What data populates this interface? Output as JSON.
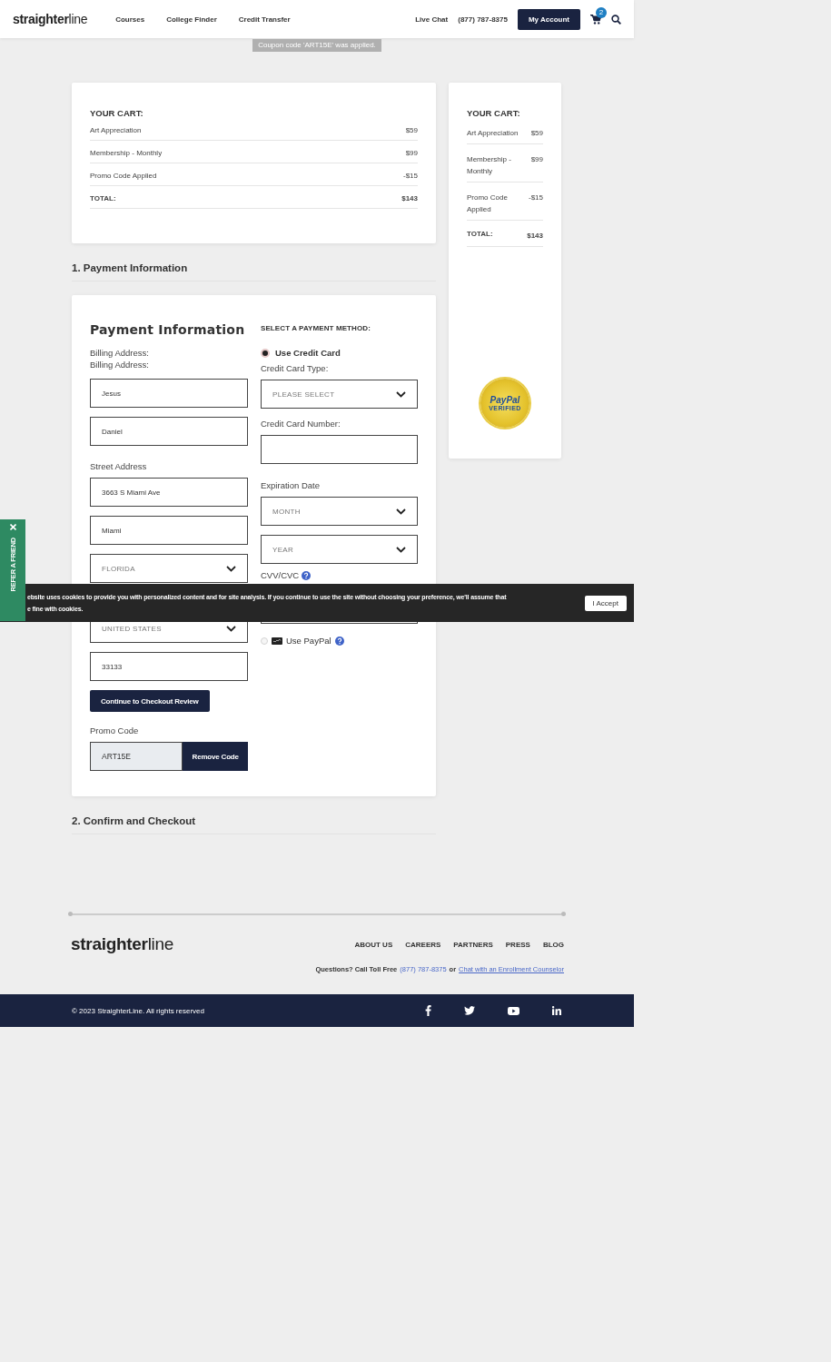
{
  "header": {
    "logo": "**straighter**line",
    "nav": [
      "Courses",
      "College Finder",
      "Credit Transfer"
    ],
    "live_chat": "Live Chat",
    "phone": "(877) 787-8375",
    "account_button": "My Account",
    "cart_count": "2"
  },
  "notice": "Coupon code 'ART15E' was applied.",
  "cart": {
    "title": "YOUR CART:",
    "items": [
      {
        "name": "Art Appreciation",
        "price": "$59"
      },
      {
        "name": "Membership - Monthly",
        "price": "$99"
      },
      {
        "name": "Promo Code Applied",
        "price": "-$15"
      }
    ],
    "total_label": "TOTAL:",
    "total": "$143"
  },
  "section_1": "1. Payment Information",
  "payment": {
    "title": "Payment Information",
    "billing_labels": [
      "Billing Address:",
      "Billing Address:"
    ],
    "first_name": "Jesus",
    "last_name": "Daniel",
    "street_label": "Street Address",
    "street": "3663 S Miami Ave",
    "city": "Miami",
    "state": "FLORIDA",
    "country": "UNITED STATES",
    "zip": "33133",
    "continue_button": "Continue to Checkout Review",
    "promo_label": "Promo Code",
    "promo_value": "ART15E",
    "remove_button": "Remove Code",
    "method_label": "SELECT A PAYMENT METHOD:",
    "methods": [
      {
        "kind": "card",
        "label": "Use Credit Card",
        "selected": true,
        "disabled": false
      },
      {
        "kind": "paypal",
        "label": "Use PayPal",
        "selected": false,
        "disabled": true
      }
    ],
    "card_type_label": "Credit Card Type:",
    "card_type": "PLEASE SELECT",
    "card_number_label": "Credit Card Number:",
    "expiration_label": "Expiration Date",
    "month": "MONTH",
    "year": "YEAR",
    "cvv_label": "CVV/CVC"
  },
  "section_2": "2. Confirm and Checkout",
  "sidebar_cart": {
    "title": "YOUR CART:",
    "items": [
      {
        "name": "Art Appreciation",
        "price": "$59"
      },
      {
        "name": "Membership - Monthly",
        "price": "$99"
      },
      {
        "name": "Promo Code Applied",
        "price": "-$15"
      }
    ],
    "total_label": "TOTAL:",
    "total": "$143",
    "seal_top": "PayPal",
    "seal_bottom": "VERIFIED"
  },
  "footer": {
    "logo": "**straighter**line",
    "links": [
      "ABOUT US",
      "CAREERS",
      "PARTNERS",
      "PRESS",
      "BLOG"
    ],
    "question": "Questions? Call Toll Free",
    "phone": "(877) 787-8375",
    "or": "or",
    "chat_link": "Chat with an Enrollment Counselor",
    "copyright": "© 2023 StraighterLine. All rights reserved"
  },
  "cookie": {
    "lines": [
      "ebsite uses cookies to provide you with personalized content and for site analysis. If you continue to use the site without choosing your preference, we'll assume that",
      "e fine with cookies."
    ],
    "accept": "I Accept"
  },
  "refer": {
    "label": "REFER A FRIEND"
  }
}
